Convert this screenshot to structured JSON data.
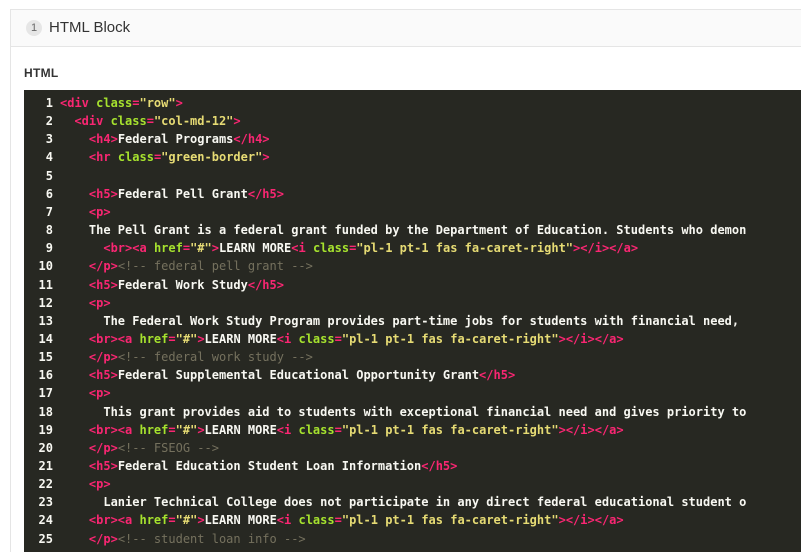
{
  "block": {
    "number": "1",
    "title": "HTML Block"
  },
  "section": {
    "label": "HTML"
  },
  "editor": {
    "language": "html",
    "theme": "monokai",
    "lines": [
      {
        "n": "1",
        "indent": "",
        "tokens": [
          [
            "tag",
            "<div "
          ],
          [
            "attr",
            "class"
          ],
          [
            "tag",
            "="
          ],
          [
            "str",
            "\"row\""
          ],
          [
            "tag",
            ">"
          ]
        ]
      },
      {
        "n": "2",
        "indent": "  ",
        "tokens": [
          [
            "tag",
            "<div "
          ],
          [
            "attr",
            "class"
          ],
          [
            "tag",
            "="
          ],
          [
            "str",
            "\"col-md-12\""
          ],
          [
            "tag",
            ">"
          ]
        ]
      },
      {
        "n": "3",
        "indent": "    ",
        "tokens": [
          [
            "tag",
            "<h4>"
          ],
          [
            "txt",
            "Federal Programs"
          ],
          [
            "tag",
            "</h4>"
          ]
        ]
      },
      {
        "n": "4",
        "indent": "    ",
        "tokens": [
          [
            "tag",
            "<hr "
          ],
          [
            "attr",
            "class"
          ],
          [
            "tag",
            "="
          ],
          [
            "str",
            "\"green-border\""
          ],
          [
            "tag",
            ">"
          ]
        ]
      },
      {
        "n": "5",
        "indent": "",
        "tokens": []
      },
      {
        "n": "6",
        "indent": "    ",
        "tokens": [
          [
            "tag",
            "<h5>"
          ],
          [
            "txt",
            "Federal Pell Grant"
          ],
          [
            "tag",
            "</h5>"
          ]
        ]
      },
      {
        "n": "7",
        "indent": "    ",
        "tokens": [
          [
            "tag",
            "<p>"
          ]
        ]
      },
      {
        "n": "8",
        "indent": "    ",
        "tokens": [
          [
            "txt",
            "The Pell Grant is a federal grant funded by the Department of Education. Students who demon"
          ]
        ]
      },
      {
        "n": "9",
        "indent": "      ",
        "tokens": [
          [
            "tag",
            "<br><a "
          ],
          [
            "attr",
            "href"
          ],
          [
            "tag",
            "="
          ],
          [
            "str",
            "\"#\""
          ],
          [
            "tag",
            ">"
          ],
          [
            "txt",
            "LEARN MORE"
          ],
          [
            "tag",
            "<i "
          ],
          [
            "attr",
            "class"
          ],
          [
            "tag",
            "="
          ],
          [
            "str",
            "\"pl-1 pt-1 fas fa-caret-right\""
          ],
          [
            "tag",
            "></i></a>"
          ]
        ]
      },
      {
        "n": "10",
        "indent": "    ",
        "tokens": [
          [
            "tag",
            "</p>"
          ],
          [
            "cmt",
            "<!-- federal pell grant -->"
          ]
        ]
      },
      {
        "n": "11",
        "indent": "    ",
        "tokens": [
          [
            "tag",
            "<h5>"
          ],
          [
            "txt",
            "Federal Work Study"
          ],
          [
            "tag",
            "</h5>"
          ]
        ]
      },
      {
        "n": "12",
        "indent": "    ",
        "tokens": [
          [
            "tag",
            "<p>"
          ]
        ]
      },
      {
        "n": "13",
        "indent": "      ",
        "tokens": [
          [
            "txt",
            "The Federal Work Study Program provides part-time jobs for students with financial need,"
          ]
        ]
      },
      {
        "n": "14",
        "indent": "    ",
        "tokens": [
          [
            "tag",
            "<br><a "
          ],
          [
            "attr",
            "href"
          ],
          [
            "tag",
            "="
          ],
          [
            "str",
            "\"#\""
          ],
          [
            "tag",
            ">"
          ],
          [
            "txt",
            "LEARN MORE"
          ],
          [
            "tag",
            "<i "
          ],
          [
            "attr",
            "class"
          ],
          [
            "tag",
            "="
          ],
          [
            "str",
            "\"pl-1 pt-1 fas fa-caret-right\""
          ],
          [
            "tag",
            "></i></a>"
          ]
        ]
      },
      {
        "n": "15",
        "indent": "    ",
        "tokens": [
          [
            "tag",
            "</p>"
          ],
          [
            "cmt",
            "<!-- federal work study -->"
          ]
        ]
      },
      {
        "n": "16",
        "indent": "    ",
        "tokens": [
          [
            "tag",
            "<h5>"
          ],
          [
            "txt",
            "Federal Supplemental Educational Opportunity Grant"
          ],
          [
            "tag",
            "</h5>"
          ]
        ]
      },
      {
        "n": "17",
        "indent": "    ",
        "tokens": [
          [
            "tag",
            "<p>"
          ]
        ]
      },
      {
        "n": "18",
        "indent": "      ",
        "tokens": [
          [
            "txt",
            "This grant provides aid to students with exceptional financial need and gives priority to"
          ]
        ]
      },
      {
        "n": "19",
        "indent": "    ",
        "tokens": [
          [
            "tag",
            "<br><a "
          ],
          [
            "attr",
            "href"
          ],
          [
            "tag",
            "="
          ],
          [
            "str",
            "\"#\""
          ],
          [
            "tag",
            ">"
          ],
          [
            "txt",
            "LEARN MORE"
          ],
          [
            "tag",
            "<i "
          ],
          [
            "attr",
            "class"
          ],
          [
            "tag",
            "="
          ],
          [
            "str",
            "\"pl-1 pt-1 fas fa-caret-right\""
          ],
          [
            "tag",
            "></i></a>"
          ]
        ]
      },
      {
        "n": "20",
        "indent": "    ",
        "tokens": [
          [
            "tag",
            "</p>"
          ],
          [
            "cmt",
            "<!-- FSEOG -->"
          ]
        ]
      },
      {
        "n": "21",
        "indent": "    ",
        "tokens": [
          [
            "tag",
            "<h5>"
          ],
          [
            "txt",
            "Federal Education Student Loan Information"
          ],
          [
            "tag",
            "</h5>"
          ]
        ]
      },
      {
        "n": "22",
        "indent": "    ",
        "tokens": [
          [
            "tag",
            "<p>"
          ]
        ]
      },
      {
        "n": "23",
        "indent": "      ",
        "tokens": [
          [
            "txt",
            "Lanier Technical College does not participate in any direct federal educational student o"
          ]
        ]
      },
      {
        "n": "24",
        "indent": "    ",
        "tokens": [
          [
            "tag",
            "<br><a "
          ],
          [
            "attr",
            "href"
          ],
          [
            "tag",
            "="
          ],
          [
            "str",
            "\"#\""
          ],
          [
            "tag",
            ">"
          ],
          [
            "txt",
            "LEARN MORE"
          ],
          [
            "tag",
            "<i "
          ],
          [
            "attr",
            "class"
          ],
          [
            "tag",
            "="
          ],
          [
            "str",
            "\"pl-1 pt-1 fas fa-caret-right\""
          ],
          [
            "tag",
            "></i></a>"
          ]
        ]
      },
      {
        "n": "25",
        "indent": "    ",
        "tokens": [
          [
            "tag",
            "</p>"
          ],
          [
            "cmt",
            "<!-- student loan info -->"
          ]
        ]
      }
    ]
  }
}
